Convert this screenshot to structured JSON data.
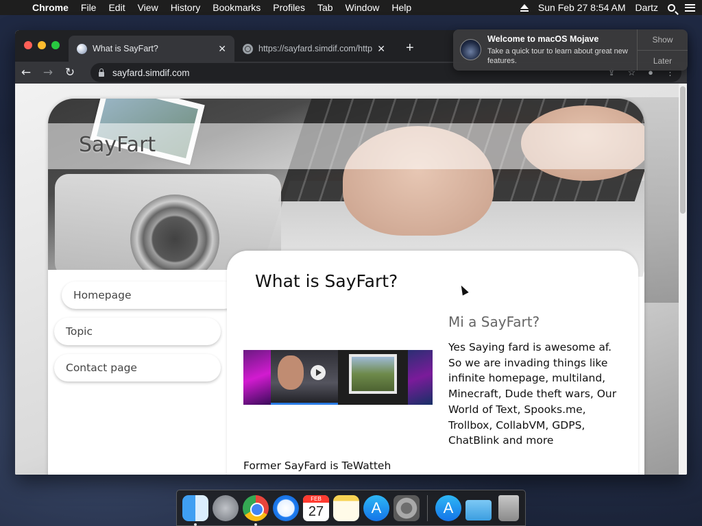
{
  "menubar": {
    "app_name": "Chrome",
    "items": [
      "File",
      "Edit",
      "View",
      "History",
      "Bookmarks",
      "Profiles",
      "Tab",
      "Window",
      "Help"
    ],
    "clock": "Sun Feb 27  8:54 AM",
    "user": "Dartz"
  },
  "browser": {
    "tabs": [
      {
        "title": "What is SayFart?",
        "active": true
      },
      {
        "title": "https://sayfard.simdif.com/http",
        "active": false
      }
    ],
    "address": "sayfard.simdif.com"
  },
  "notification": {
    "title": "Welcome to macOS Mojave",
    "body": "Take a quick tour to learn about great new features.",
    "show_label": "Show",
    "later_label": "Later"
  },
  "site": {
    "title": "SayFart",
    "nav": [
      "Homepage",
      "Topic",
      "Contact page"
    ],
    "heading": "What is SayFart?",
    "subheading": "Mi a SayFart?",
    "body": "Yes Saying fard is awesome af. So we are invading things like infinite homepage, multiland, Minecraft, Dude theft wars, Our World of Text, Spooks.me, Trollbox, CollabVM, GDPS, ChatBlink and more",
    "footer_text": "Former SayFard is TeWatteh"
  },
  "dock": {
    "calendar_month": "FEB",
    "calendar_day": "27",
    "apps": [
      "finder-icon",
      "launchpad-icon",
      "chrome-icon",
      "safari-icon",
      "calendar-icon",
      "notes-icon",
      "app-store-icon",
      "system-preferences-icon",
      "app-store-icon",
      "downloads-folder-icon",
      "trash-icon"
    ]
  },
  "colors": {
    "menubar": "#1e1e1e",
    "tab_active": "#35363a",
    "tab_bar": "#202124",
    "accent_blue": "#2a7be4"
  }
}
